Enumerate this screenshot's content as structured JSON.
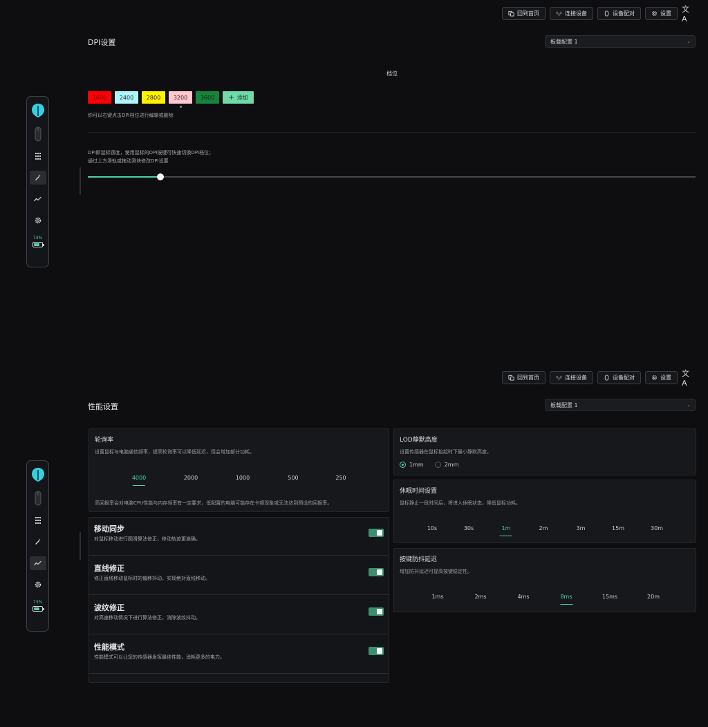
{
  "topbar": {
    "home": "回到首页",
    "connect": "连接设备",
    "pair": "设备配对",
    "settings": "设置",
    "lang": "文A"
  },
  "profile": {
    "selected": "板载配置 1"
  },
  "sidebar": {
    "battery": "73%",
    "battery_level": 0.73
  },
  "dpi": {
    "title": "DPI设置",
    "section": "档位",
    "chips": [
      {
        "value": "1600",
        "color": "#ff0000",
        "text_color": "#7a0000"
      },
      {
        "value": "2400",
        "color": "#aef6ff",
        "text_color": "#1b2a2c"
      },
      {
        "value": "2800",
        "color": "#fff200",
        "text_color": "#2b2700"
      },
      {
        "value": "3200",
        "color": "#ffc9cf",
        "text_color": "#3a2226"
      },
      {
        "value": "3600",
        "color": "#16843c",
        "text_color": "#0c2413"
      }
    ],
    "active_chip": 3,
    "add": "添加",
    "hint": "你可以右键点击DPI档位进行编辑或删除",
    "desc1": "DPI即鼠标感度，使用鼠标的DPI按键可快速切换DPI档位；",
    "desc2": "通过上方滑轨或拖动滑块修改DPI设置",
    "slider_value": 3200,
    "slider_min": 100,
    "slider_max": 26000
  },
  "perf": {
    "title": "性能设置",
    "polling": {
      "title": "轮询率",
      "desc": "设置鼠标与电脑通信频率，提高轮询率可以降低延迟，但会增加部分功耗。",
      "options": [
        "4000",
        "2000",
        "1000",
        "500",
        "250"
      ],
      "active": 0,
      "note": "高回报率会对电脑CPU性能与内存频率有一定要求，低配置的电脑可能存在卡顿现象或无法达到预设的回报率。"
    },
    "toggles": [
      {
        "title": "移动同步",
        "desc": "对鼠标移动进行圆滑算法修正，移动轨迹更准确。"
      },
      {
        "title": "直线修正",
        "desc": "修正直线移动鼠标时的偏移抖动，实现绝对直线移动。"
      },
      {
        "title": "波纹修正",
        "desc": "对高速移动情况下进行算法修正，消除波纹抖动。"
      },
      {
        "title": "性能模式",
        "desc": "性能模式可以让您的传感器发挥最佳性能，消耗更多的电力。"
      }
    ],
    "lod": {
      "title": "LOD静默高度",
      "desc": "设置传感器在鼠标抬起时下最小静默高度。",
      "options": [
        "1mm",
        "2mm"
      ],
      "active": 0
    },
    "sleep": {
      "title": "休眠时间设置",
      "desc": "鼠标静止一段时间后，将进入休眠状态，降低鼠标功耗。",
      "options": [
        "10s",
        "30s",
        "1m",
        "2m",
        "3m",
        "15m",
        "30m"
      ],
      "active": 2
    },
    "debounce": {
      "title": "按键防抖延迟",
      "desc": "增加防抖延迟可提高按键稳定性。",
      "options": [
        "1ms",
        "2ms",
        "4ms",
        "8ms",
        "15ms",
        "20m"
      ],
      "active": 3
    }
  }
}
